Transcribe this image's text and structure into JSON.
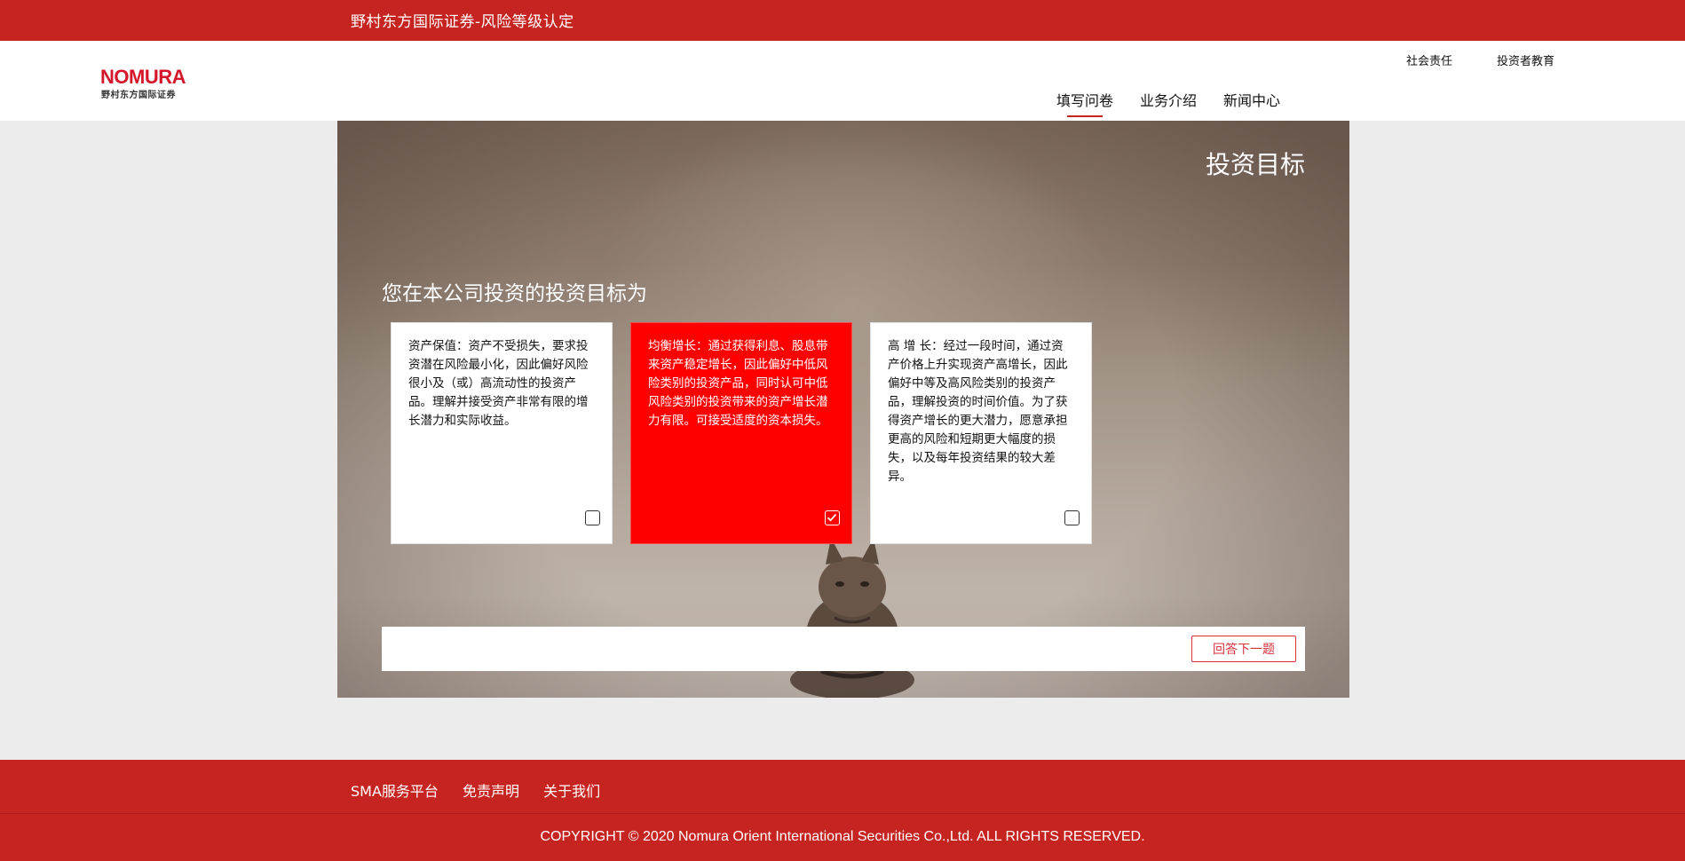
{
  "topbar": {
    "title": "野村东方国际证券-风险等级认定"
  },
  "logo": {
    "mark": "NOMURA",
    "sub": "野村东方国际证券"
  },
  "header": {
    "util_links": [
      "社会责任",
      "投资者教育"
    ],
    "nav": [
      {
        "label": "填写问卷",
        "active": true
      },
      {
        "label": "业务介绍",
        "active": false
      },
      {
        "label": "新闻中心",
        "active": false
      }
    ]
  },
  "main": {
    "section_title": "投资目标",
    "question": "您在本公司投资的投资目标为",
    "options": [
      {
        "text": "资产保值：资产不受损失，要求投资潜在风险最小化，因此偏好风险很小及（或）高流动性的投资产品。理解并接受资产非常有限的增长潜力和实际收益。",
        "selected": false
      },
      {
        "text": "均衡增长：通过获得利息、股息带来资产稳定增长，因此偏好中低风险类别的投资产品，同时认可中低风险类别的投资带来的资产增长潜力有限。可接受适度的资本损失。",
        "selected": true
      },
      {
        "text": "高 增 长：经过一段时间，通过资产价格上升实现资产高增长，因此偏好中等及高风险类别的投资产品，理解投资的时间价值。为了获得资产增长的更大潜力，愿意承担更高的风险和短期更大幅度的损失，以及每年投资结果的较大差异。",
        "selected": false
      }
    ],
    "next_button": "回答下一题"
  },
  "footer": {
    "links": [
      "SMA服务平台",
      "免责声明",
      "关于我们"
    ],
    "copyright": "COPYRIGHT © 2020 Nomura Orient International Securities Co.,Ltd. ALL RIGHTS RESERVED."
  },
  "colors": {
    "brand_red": "#c62421",
    "selected_red": "#ff0000",
    "logo_red": "#d4172a"
  }
}
